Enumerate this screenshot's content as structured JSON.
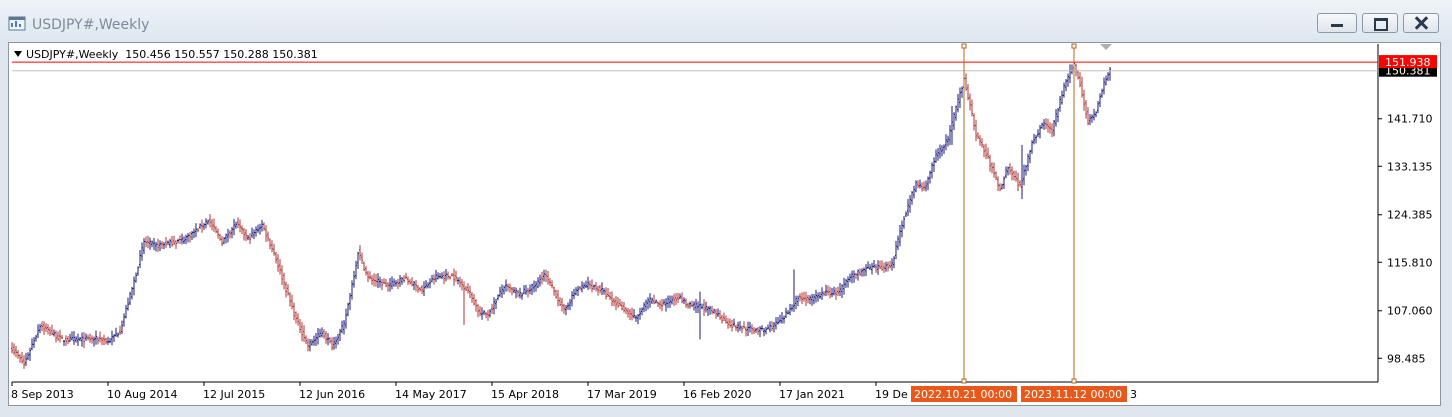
{
  "window": {
    "title": "USDJPY#,Weekly",
    "icon": "chart-window-icon"
  },
  "info_line": {
    "symbol": "USDJPY#,Weekly",
    "ohlc": "150.456 150.557 150.288 150.381"
  },
  "colors": {
    "bull_bar": "#1a1a7a",
    "bear_bar": "#b03030",
    "level_line": "#ff0000",
    "vline": "#b5651d",
    "level_label_bg": "#ff0000",
    "price_label_bg": "#000000",
    "time_label_bg": "#e8581a"
  },
  "chart_data": {
    "type": "bar",
    "symbol": "USDJPY#",
    "timeframe": "Weekly",
    "ylim": [
      94.2,
      155.2
    ],
    "y_ticks": [
      "98.485",
      "107.060",
      "115.810",
      "124.385",
      "133.135",
      "141.710"
    ],
    "x_ticks": [
      "8 Sep 2013",
      "10 Aug 2014",
      "12 Jul 2015",
      "12 Jun 2016",
      "14 May 2017",
      "15 Apr 2018",
      "17 Mar 2019",
      "16 Feb 2020",
      "17 Jan 2021",
      "19 De"
    ],
    "x_tick_tail": "3",
    "horizontal_line": {
      "price": 151.938,
      "label": "151.938"
    },
    "current_price": {
      "price": 150.381,
      "label": "150.381"
    },
    "vertical_lines": [
      {
        "index": 476,
        "label": "2022.10.21 00:00"
      },
      {
        "index": 531,
        "label": "2023.11.12 00:00"
      }
    ],
    "bar_count": 550,
    "anchors": [
      [
        0,
        100.3
      ],
      [
        6,
        97.4
      ],
      [
        14,
        104.5
      ],
      [
        25,
        101.8
      ],
      [
        45,
        102.0
      ],
      [
        48,
        101.4
      ],
      [
        54,
        103.5
      ],
      [
        60,
        111.0
      ],
      [
        66,
        119.5
      ],
      [
        72,
        118.8
      ],
      [
        85,
        119.8
      ],
      [
        92,
        121.5
      ],
      [
        98,
        123.5
      ],
      [
        105,
        119.5
      ],
      [
        112,
        122.8
      ],
      [
        118,
        120.0
      ],
      [
        125,
        122.6
      ],
      [
        131,
        117.5
      ],
      [
        142,
        105.5
      ],
      [
        148,
        100.8
      ],
      [
        155,
        103.2
      ],
      [
        160,
        100.8
      ],
      [
        166,
        104.5
      ],
      [
        172,
        115.5
      ],
      [
        173,
        117.8
      ],
      [
        178,
        113.0
      ],
      [
        188,
        111.6
      ],
      [
        196,
        112.9
      ],
      [
        205,
        110.8
      ],
      [
        212,
        113.2
      ],
      [
        220,
        113.4
      ],
      [
        228,
        110.8
      ],
      [
        234,
        106.5
      ],
      [
        238,
        106.5
      ],
      [
        246,
        111.5
      ],
      [
        254,
        110.0
      ],
      [
        262,
        111.7
      ],
      [
        266,
        113.7
      ],
      [
        271,
        110.6
      ],
      [
        276,
        107.0
      ],
      [
        282,
        110.8
      ],
      [
        288,
        111.8
      ],
      [
        295,
        110.7
      ],
      [
        300,
        108.8
      ],
      [
        305,
        107.7
      ],
      [
        312,
        105.6
      ],
      [
        318,
        108.9
      ],
      [
        325,
        108.2
      ],
      [
        333,
        109.6
      ],
      [
        338,
        108.0
      ],
      [
        345,
        107.8
      ],
      [
        352,
        106.6
      ],
      [
        360,
        104.4
      ],
      [
        368,
        103.8
      ],
      [
        376,
        103.5
      ],
      [
        385,
        105.3
      ],
      [
        393,
        109.5
      ],
      [
        400,
        109.1
      ],
      [
        406,
        110.3
      ],
      [
        413,
        110.3
      ],
      [
        420,
        113.5
      ],
      [
        428,
        114.7
      ],
      [
        436,
        114.9
      ],
      [
        440,
        115.5
      ],
      [
        446,
        124.0
      ],
      [
        452,
        130.0
      ],
      [
        456,
        129.0
      ],
      [
        462,
        135.0
      ],
      [
        468,
        138.0
      ],
      [
        476,
        149.0
      ],
      [
        482,
        139.0
      ],
      [
        488,
        134.5
      ],
      [
        494,
        129.0
      ],
      [
        498,
        133.2
      ],
      [
        504,
        129.5
      ],
      [
        510,
        137.5
      ],
      [
        516,
        141.0
      ],
      [
        520,
        139.5
      ],
      [
        526,
        147.5
      ],
      [
        531,
        151.5
      ],
      [
        534,
        148.0
      ],
      [
        538,
        141.2
      ],
      [
        542,
        143.2
      ],
      [
        546,
        148.0
      ],
      [
        549,
        150.4
      ]
    ],
    "spikes": [
      [
        226,
        109.8,
        104.5
      ],
      [
        344,
        110.5,
        101.9
      ],
      [
        391,
        114.5,
        110.0
      ],
      [
        470,
        144.0,
        137.0
      ],
      [
        505,
        137.0,
        127.2
      ]
    ]
  }
}
